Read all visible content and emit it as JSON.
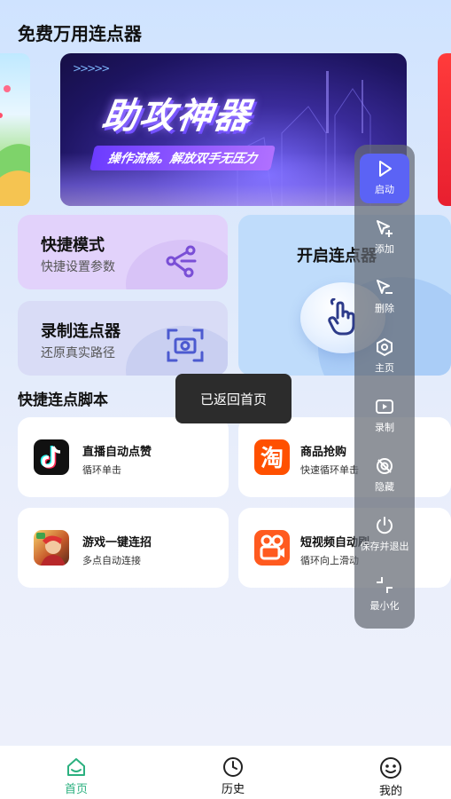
{
  "page": {
    "title": "免费万用连点器"
  },
  "banner": {
    "title": "助攻神器",
    "subtitle": "操作流畅。解放双手无压力",
    "arrows": ">>>>>"
  },
  "modes": {
    "quick": {
      "title": "快捷模式",
      "subtitle": "快捷设置参数"
    },
    "record": {
      "title": "录制连点器",
      "subtitle": "还原真实路径"
    },
    "start": {
      "title": "开启连点器"
    }
  },
  "scripts": {
    "section_title": "快捷连点脚本",
    "items": [
      {
        "name": "直播自动点赞",
        "desc": "循环单击",
        "icon": "tiktok-icon"
      },
      {
        "name": "商品抢购",
        "desc": "快速循环单击",
        "icon": "taobao-icon"
      },
      {
        "name": "游戏一键连招",
        "desc": "多点自动连接",
        "icon": "game-avatar-icon"
      },
      {
        "name": "短视频自动刷",
        "desc": "循环向上滑动",
        "icon": "kuaishou-icon"
      }
    ]
  },
  "toast": {
    "text": "已返回首页"
  },
  "float_panel": {
    "items": [
      {
        "label": "启动",
        "icon": "play-icon"
      },
      {
        "label": "添加",
        "icon": "add-cursor-icon"
      },
      {
        "label": "删除",
        "icon": "remove-cursor-icon"
      },
      {
        "label": "主页",
        "icon": "home-hex-icon"
      },
      {
        "label": "录制",
        "icon": "record-video-icon"
      },
      {
        "label": "隐藏",
        "icon": "hide-icon"
      },
      {
        "label": "保存并退出",
        "icon": "power-icon"
      },
      {
        "label": "最小化",
        "icon": "minimize-icon"
      }
    ]
  },
  "bottom_nav": {
    "items": [
      {
        "label": "首页",
        "icon": "home-icon",
        "active": true
      },
      {
        "label": "历史",
        "icon": "clock-icon",
        "active": false
      },
      {
        "label": "我的",
        "icon": "smile-icon",
        "active": false
      }
    ]
  },
  "colors": {
    "accent": "#5b63f5",
    "active_nav": "#2bb07f",
    "quick_card": "#e2d2fb",
    "record_card": "#d9dcf6",
    "start_card": "#bfdcfb"
  }
}
